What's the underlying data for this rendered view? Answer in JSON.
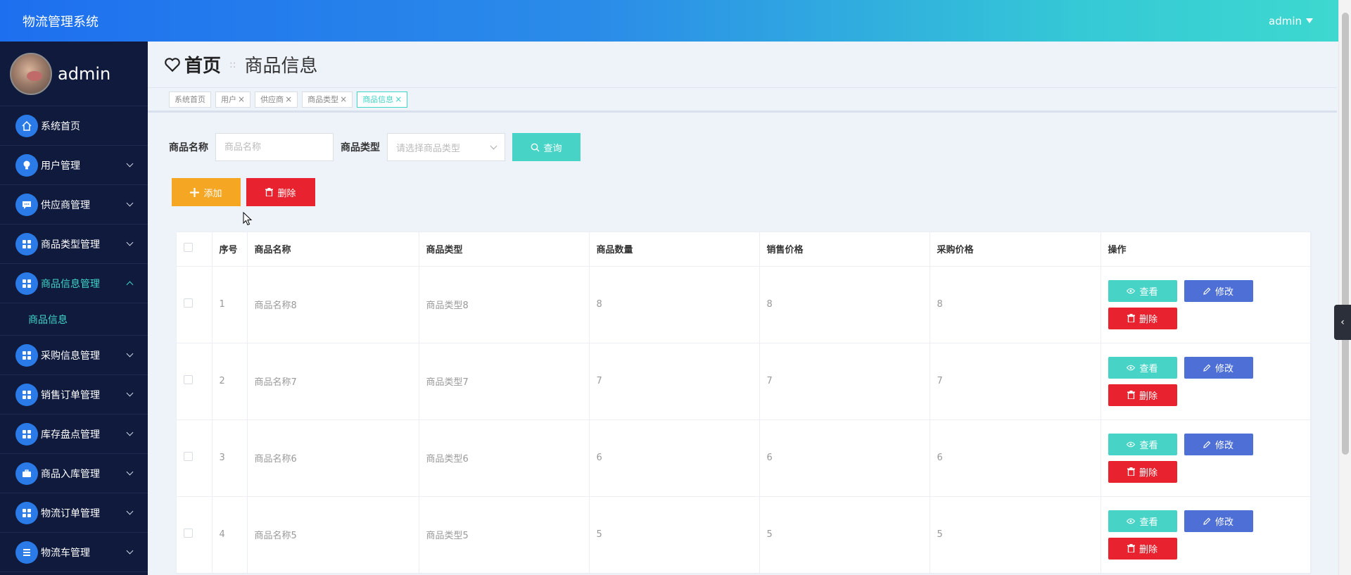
{
  "header": {
    "title": "物流管理系统",
    "user": "admin"
  },
  "sidebar": {
    "profile_name": "admin",
    "items": [
      {
        "label": "系统首页",
        "icon": "home-icon"
      },
      {
        "label": "用户管理",
        "icon": "bulb-icon"
      },
      {
        "label": "供应商管理",
        "icon": "chat-icon"
      },
      {
        "label": "商品类型管理",
        "icon": "grid-icon"
      },
      {
        "label": "商品信息管理",
        "icon": "grid-icon"
      },
      {
        "label": "采购信息管理",
        "icon": "grid-icon"
      },
      {
        "label": "销售订单管理",
        "icon": "grid-icon"
      },
      {
        "label": "库存盘点管理",
        "icon": "grid-icon"
      },
      {
        "label": "商品入库管理",
        "icon": "briefcase-icon"
      },
      {
        "label": "物流订单管理",
        "icon": "grid-icon"
      },
      {
        "label": "物流车管理",
        "icon": "list-icon"
      }
    ],
    "submenu": {
      "label": "商品信息"
    }
  },
  "page": {
    "home": "首页",
    "current": "商品信息"
  },
  "tags": [
    {
      "label": "系统首页"
    },
    {
      "label": "用户"
    },
    {
      "label": "供应商"
    },
    {
      "label": "商品类型"
    },
    {
      "label": "商品信息"
    }
  ],
  "search": {
    "name_label": "商品名称",
    "name_placeholder": "商品名称",
    "type_label": "商品类型",
    "type_placeholder": "请选择商品类型",
    "query_label": "查询"
  },
  "toolbar": {
    "add_label": "添加",
    "delete_label": "删除"
  },
  "table": {
    "headers": [
      "序号",
      "商品名称",
      "商品类型",
      "商品数量",
      "销售价格",
      "采购价格",
      "操作"
    ],
    "rows": [
      {
        "no": "1",
        "name": "商品名称8",
        "type": "商品类型8",
        "qty": "8",
        "sale": "8",
        "purchase": "8"
      },
      {
        "no": "2",
        "name": "商品名称7",
        "type": "商品类型7",
        "qty": "7",
        "sale": "7",
        "purchase": "7"
      },
      {
        "no": "3",
        "name": "商品名称6",
        "type": "商品类型6",
        "qty": "6",
        "sale": "6",
        "purchase": "6"
      },
      {
        "no": "4",
        "name": "商品名称5",
        "type": "商品类型5",
        "qty": "5",
        "sale": "5",
        "purchase": "5"
      }
    ],
    "view_label": "查看",
    "edit_label": "修改",
    "delete_label": "删除"
  },
  "colors": {
    "accent": "#47d4c7",
    "danger": "#e8232f",
    "warning": "#f5a623",
    "primary": "#4d6fd6",
    "sidebar": "#0f1a3c"
  }
}
